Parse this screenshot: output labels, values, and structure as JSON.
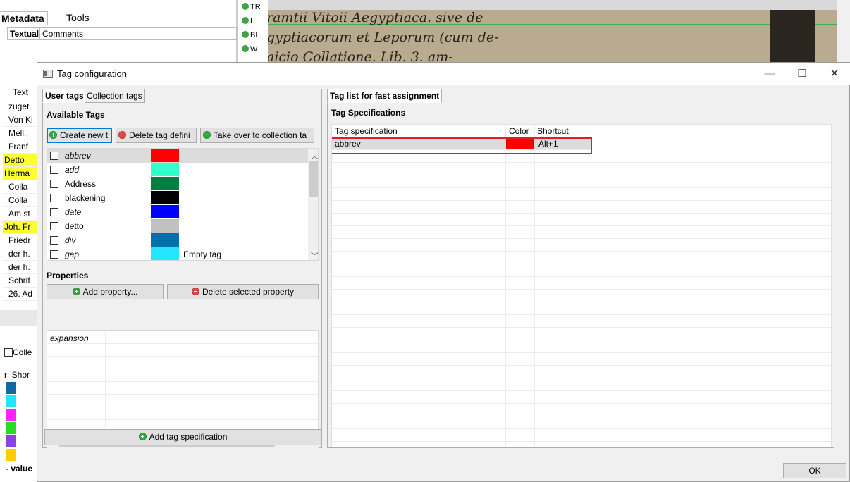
{
  "background": {
    "tabs": [
      "Metadata",
      "Tools"
    ],
    "subtabs": [
      "Textual",
      "Comments"
    ],
    "corner_labels": [
      "TR",
      "L",
      "BL",
      "W"
    ],
    "text_column_header": "Text",
    "text_rows": [
      {
        "text": "zuget",
        "highlight": false
      },
      {
        "text": "Von Ki",
        "highlight": false
      },
      {
        "text": "Mell.",
        "highlight": false
      },
      {
        "text": "Franf",
        "highlight": false
      },
      {
        "text": "Detto",
        "highlight": true
      },
      {
        "text": "Herma",
        "highlight": true
      },
      {
        "text": "Colla",
        "highlight": false
      },
      {
        "text": "Colla",
        "highlight": false
      },
      {
        "text": "Am st",
        "highlight": false
      },
      {
        "text": "Joh. Fr",
        "highlight": true
      },
      {
        "text": "Friedr",
        "highlight": false
      },
      {
        "text": "der h.",
        "highlight": false
      },
      {
        "text": "der h.",
        "highlight": false
      },
      {
        "text": "Schrif",
        "highlight": false
      },
      {
        "text": "26. Ad",
        "highlight": false
      }
    ],
    "collection_checkbox_label": "Colle",
    "short_header": "Shor",
    "short_header_prefix": "r",
    "value_label": "- value",
    "swatch_colors": [
      "#0e6aa0",
      "#22e5ff",
      "#ff22ff",
      "#22dd22",
      "#8844dd",
      "#ffcc00"
    ],
    "doc_lines": [
      "ramtii Vitoii Aegyptiaca. sive de",
      "gyptiacorum et Leporum (cum de-",
      "aicio Collatione. Lib. 3. am-"
    ]
  },
  "dialog": {
    "title": "Tag configuration",
    "window_buttons": {
      "minimize": "—",
      "maximize": "☐",
      "close": "✕"
    },
    "left_tabs": [
      "User tags",
      "Collection tags"
    ],
    "available_tags_title": "Available Tags",
    "buttons": {
      "create": "Create new t",
      "delete_def": "Delete tag defini",
      "take_over": "Take over to collection ta",
      "add_property": "Add property...",
      "delete_property": "Delete selected property",
      "add_spec": "Add tag specification",
      "ok": "OK"
    },
    "tags": [
      {
        "name": "abbrev",
        "italic": true,
        "color": "#ff0000",
        "extra": "",
        "selected": true
      },
      {
        "name": "add",
        "italic": true,
        "color": "#33ffcc",
        "extra": "",
        "selected": false
      },
      {
        "name": "Address",
        "italic": false,
        "color": "#008040",
        "extra": "",
        "selected": false
      },
      {
        "name": "blackening",
        "italic": false,
        "color": "#000000",
        "extra": "",
        "selected": false
      },
      {
        "name": "date",
        "italic": true,
        "color": "#0000ff",
        "extra": "",
        "selected": false
      },
      {
        "name": "detto",
        "italic": false,
        "color": "#c0c0c0",
        "extra": "",
        "selected": false
      },
      {
        "name": "div",
        "italic": true,
        "color": "#0070a8",
        "extra": "",
        "selected": false
      },
      {
        "name": "gap",
        "italic": true,
        "color": "#22e5ff",
        "extra": "Empty tag",
        "selected": false
      }
    ],
    "properties_title": "Properties",
    "properties": [
      "expansion"
    ],
    "right_tab": "Tag list for fast assignment",
    "spec_title": "Tag Specifications",
    "spec_headers": {
      "spec": "Tag specification",
      "color": "Color",
      "shortcut": "Shortcut"
    },
    "spec_rows": [
      {
        "spec": "abbrev",
        "color": "#ff0000",
        "shortcut": "Alt+1"
      }
    ]
  }
}
